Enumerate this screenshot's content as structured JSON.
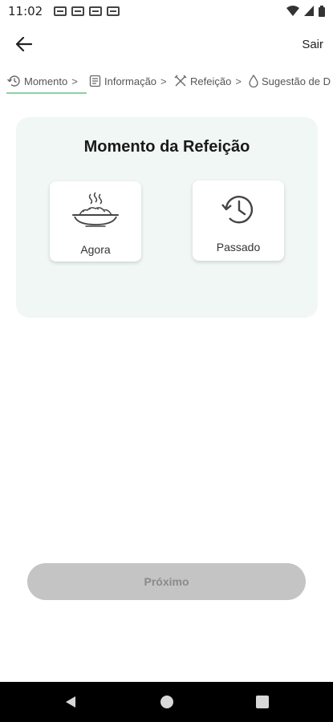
{
  "status_bar": {
    "time": "11:02"
  },
  "app_bar": {
    "exit_label": "Sair"
  },
  "steps": [
    {
      "label": "Momento",
      "icon": "history-icon"
    },
    {
      "label": "Informação",
      "icon": "document-icon"
    },
    {
      "label": "Refeição",
      "icon": "utensils-icon"
    },
    {
      "label": "Sugestão de D",
      "icon": "drop-icon"
    }
  ],
  "card": {
    "title": "Momento da Refeição",
    "options": [
      {
        "label": "Agora",
        "icon": "steaming-dish-icon"
      },
      {
        "label": "Passado",
        "icon": "history-clock-icon"
      }
    ]
  },
  "footer": {
    "next_label": "Próximo"
  },
  "colors": {
    "card_bg": "#f0f7f5",
    "active_step_underline": "#8fcfa5",
    "disabled_button": "#c4c4c4"
  }
}
